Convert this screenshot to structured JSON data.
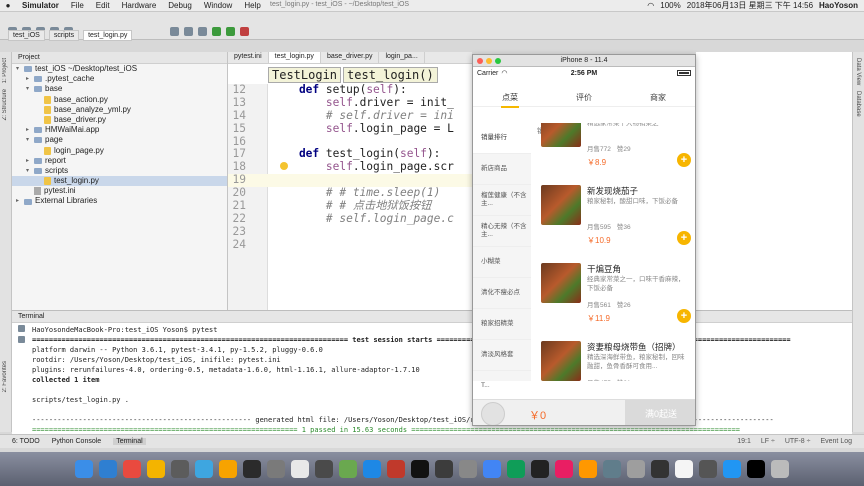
{
  "menubar": {
    "app": "Simulator",
    "items": [
      "File",
      "Edit",
      "Hardware",
      "Debug",
      "Window",
      "Help"
    ],
    "window_title": "test_login.py - test_iOS - ~/Desktop/test_iOS",
    "battery": "100%",
    "datetime": "2018年06月13日 星期三 下午 14:56",
    "user": "HaoYoson"
  },
  "ide": {
    "breadcrumbs": [
      "test_iOS",
      "scripts",
      "test_login.py"
    ],
    "project_header": "Project",
    "tree": [
      {
        "label": "test_iOS  ~/Desktop/test_iOS",
        "type": "folder",
        "indent": 0,
        "arrow": "▾"
      },
      {
        "label": ".pytest_cache",
        "type": "folder",
        "indent": 1,
        "arrow": "▸"
      },
      {
        "label": "base",
        "type": "folder",
        "indent": 1,
        "arrow": "▾"
      },
      {
        "label": "base_action.py",
        "type": "py",
        "indent": 2,
        "arrow": ""
      },
      {
        "label": "base_analyze_yml.py",
        "type": "py",
        "indent": 2,
        "arrow": ""
      },
      {
        "label": "base_driver.py",
        "type": "py",
        "indent": 2,
        "arrow": ""
      },
      {
        "label": "HMWaiMai.app",
        "type": "folder",
        "indent": 1,
        "arrow": "▸"
      },
      {
        "label": "page",
        "type": "folder",
        "indent": 1,
        "arrow": "▾"
      },
      {
        "label": "login_page.py",
        "type": "py",
        "indent": 2,
        "arrow": ""
      },
      {
        "label": "report",
        "type": "folder",
        "indent": 1,
        "arrow": "▸"
      },
      {
        "label": "scripts",
        "type": "folder",
        "indent": 1,
        "arrow": "▾"
      },
      {
        "label": "test_login.py",
        "type": "py",
        "indent": 2,
        "arrow": "",
        "selected": true
      },
      {
        "label": "pytest.ini",
        "type": "ini",
        "indent": 1,
        "arrow": ""
      },
      {
        "label": "External Libraries",
        "type": "folder",
        "indent": 0,
        "arrow": "▸"
      }
    ],
    "editor_tabs": [
      "pytest.ini",
      "test_login.py",
      "base_driver.py",
      "login_pa..."
    ],
    "code_crumbs": [
      "TestLogin",
      "test_login()"
    ],
    "left_tools": [
      "1: Project",
      "Z: Structure"
    ],
    "right_tools": [
      "Data View",
      "Database"
    ],
    "left_bottom_tool": "2: Favorites"
  },
  "code_lines": [
    {
      "num": "12",
      "parts": [
        {
          "c": "kw",
          "t": "    def "
        },
        {
          "c": "",
          "t": "setup("
        },
        {
          "c": "slf",
          "t": "self"
        },
        {
          "c": "",
          "t": "):"
        }
      ]
    },
    {
      "num": "13",
      "parts": [
        {
          "c": "slf",
          "t": "        self"
        },
        {
          "c": "",
          "t": ".driver = init_"
        }
      ]
    },
    {
      "num": "14",
      "parts": [
        {
          "c": "cm",
          "t": "        # self.driver = ini"
        }
      ]
    },
    {
      "num": "15",
      "parts": [
        {
          "c": "slf",
          "t": "        self"
        },
        {
          "c": "",
          "t": ".login_page = L"
        }
      ]
    },
    {
      "num": "16",
      "parts": [
        {
          "c": "",
          "t": ""
        }
      ]
    },
    {
      "num": "17",
      "parts": [
        {
          "c": "kw",
          "t": "    def "
        },
        {
          "c": "",
          "t": "test_login("
        },
        {
          "c": "slf",
          "t": "self"
        },
        {
          "c": "",
          "t": "):"
        }
      ]
    },
    {
      "num": "18",
      "parts": [
        {
          "c": "slf",
          "t": "        self"
        },
        {
          "c": "",
          "t": ".login_page.scr"
        }
      ]
    },
    {
      "num": "19",
      "parts": [
        {
          "c": "",
          "t": ""
        }
      ],
      "current": true
    },
    {
      "num": "20",
      "parts": [
        {
          "c": "cm",
          "t": "        # # time.sleep(1)"
        }
      ]
    },
    {
      "num": "21",
      "parts": [
        {
          "c": "cm",
          "t": "        # # 点击地狱饭按钮"
        }
      ]
    },
    {
      "num": "22",
      "parts": [
        {
          "c": "cm",
          "t": "        # self.login_page.c"
        }
      ]
    },
    {
      "num": "23",
      "parts": [
        {
          "c": "",
          "t": ""
        }
      ]
    },
    {
      "num": "24",
      "parts": [
        {
          "c": "",
          "t": ""
        }
      ]
    }
  ],
  "terminal": {
    "header": "Terminal",
    "lines": [
      {
        "t": "HaoYosondeMacBook-Pro:test_iOS Yoson$ pytest",
        "s": ""
      },
      {
        "t": "=========================================================================== test session starts ====================================================================================",
        "s": "b"
      },
      {
        "t": "platform darwin -- Python 3.6.1, pytest-3.4.1, py-1.5.2, pluggy-0.6.0",
        "s": ""
      },
      {
        "t": "rootdir: /Users/Yoson/Desktop/test_iOS, inifile: pytest.ini",
        "s": ""
      },
      {
        "t": "plugins: rerunfailures-4.0, ordering-0.5, metadata-1.6.0, html-1.16.1, allure-adaptor-1.7.10",
        "s": ""
      },
      {
        "t": "collected 1 item",
        "s": "b"
      },
      {
        "t": "",
        "s": ""
      },
      {
        "t": "scripts/test_login.py .",
        "s": ""
      },
      {
        "t": "",
        "s": ""
      },
      {
        "t": "---------------------------------------------------- generated html file: /Users/Yoson/Desktop/test_iOS/report/report.html -----------------------------------------------------",
        "s": ""
      },
      {
        "t": "=============================================================== 1 passed in 15.63 seconds ==============================================================================",
        "s": "g"
      },
      {
        "t": "HaoYosondeMacBook-Pro:test_iOS Yoson$ ",
        "s": ""
      }
    ]
  },
  "statusbar": {
    "tools": [
      "6: TODO",
      "Python Console",
      "Terminal"
    ],
    "event_log": "Event Log",
    "position": "19:1",
    "line_sep": "LF ÷",
    "encoding": "UTF-8 ÷"
  },
  "simulator": {
    "title": "iPhone 8 - 11.4",
    "carrier": "Carrier",
    "time": "2:56 PM",
    "tabs": [
      "点菜",
      "评价",
      "商家"
    ],
    "categories": [
      "销量排行",
      "新店商品",
      "榴莲健康（不含主...",
      "精心无辣（不含主...",
      "小糊菜",
      "清化不瘦必点",
      "粮家招精菜",
      "清淡风格套",
      "T..."
    ],
    "section": "销量排行",
    "foods": [
      {
        "name": "",
        "desc": "精选家常菜十大畅销菜之一",
        "sales": "月售772",
        "likes": "赞29",
        "price": "￥8.9"
      },
      {
        "name": "新发现烧茄子",
        "desc": "粮家秘制，酸甜口味，下饭必备",
        "sales": "月售595",
        "likes": "赞36",
        "price": "￥10.9"
      },
      {
        "name": "干煸豆角",
        "desc": "经典家常菜之一，口味干香麻辣，下饭必备",
        "sales": "月售561",
        "likes": "赞26",
        "price": "￥11.9"
      },
      {
        "name": "资妻粮母烧带鱼（招牌）",
        "desc": "精选深海鲜带鱼，粮家秘制，回味融甜，鱼骨香酥可食用...",
        "sales": "月售475",
        "likes": "赞21",
        "price": ""
      }
    ],
    "cart_total": "￥0",
    "cart_button": "满0起送",
    "add_icon": "+"
  },
  "colors": {
    "accent": "#f7b500",
    "price": "#f56b2a"
  }
}
